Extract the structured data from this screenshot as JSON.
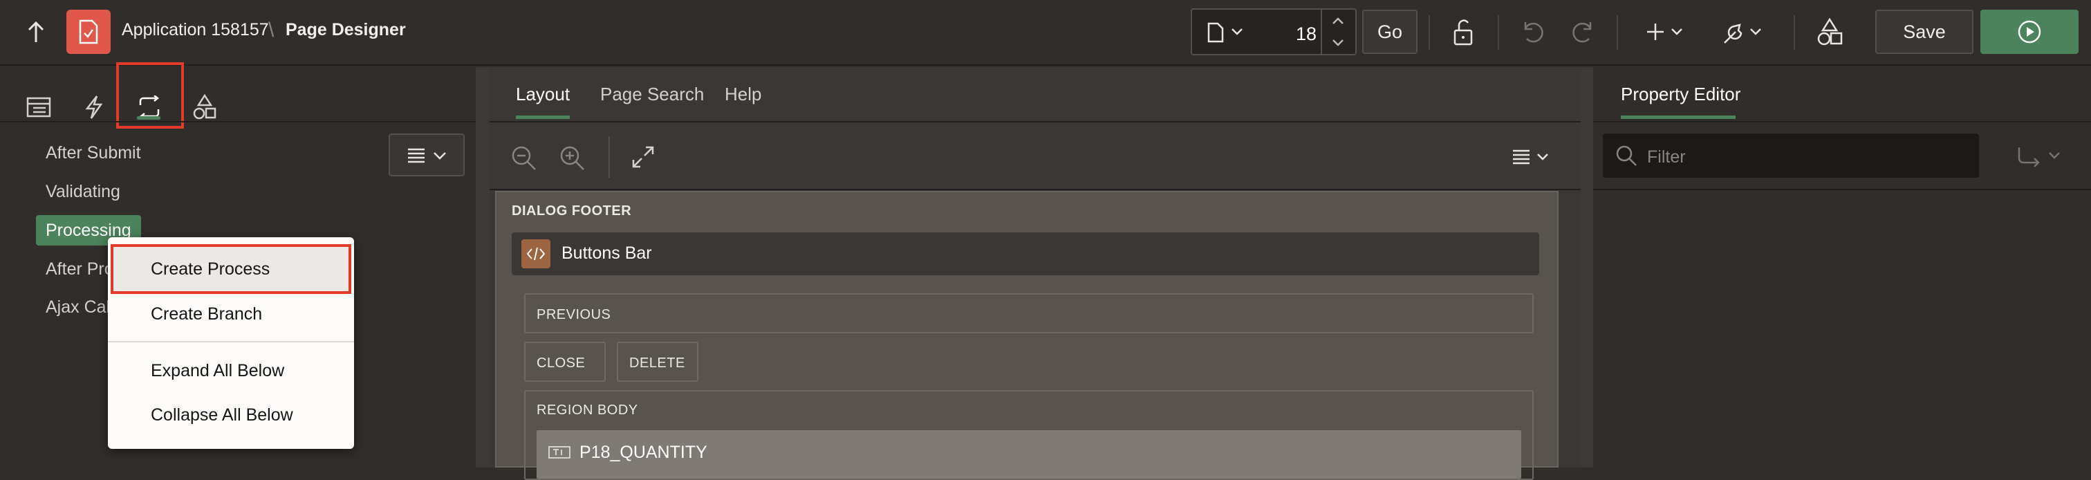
{
  "header": {
    "app_title": "Application 158157",
    "separator": "\\",
    "page_title": "Page Designer",
    "page_number": "18",
    "go_label": "Go",
    "save_label": "Save"
  },
  "left_panel": {
    "tabs": [
      "rendering-icon",
      "dynamic-actions-icon",
      "processing-icon",
      "shared-components-icon"
    ],
    "tree": [
      {
        "label": "After Submit"
      },
      {
        "label": "Validating"
      },
      {
        "label": "Processing"
      },
      {
        "label": "After Pro"
      },
      {
        "label": "Ajax Cal"
      }
    ]
  },
  "context_menu": {
    "items": [
      {
        "label": "Create Process"
      },
      {
        "label": "Create Branch"
      },
      {
        "label": "Expand All Below"
      },
      {
        "label": "Collapse All Below"
      }
    ]
  },
  "center": {
    "tabs": [
      {
        "label": "Layout"
      },
      {
        "label": "Page Search"
      },
      {
        "label": "Help"
      }
    ],
    "dialog_footer": "DIALOG FOOTER",
    "buttons_bar": "Buttons Bar",
    "previous": "PREVIOUS",
    "close": "CLOSE",
    "delete": "DELETE",
    "region_body": "REGION BODY",
    "item": "P18_QUANTITY"
  },
  "right_panel": {
    "tab": "Property Editor",
    "filter_placeholder": "Filter"
  },
  "colors": {
    "accent_green": "#4c825c",
    "highlight_red": "#e23b2a",
    "app_icon_red": "#e0574b"
  }
}
